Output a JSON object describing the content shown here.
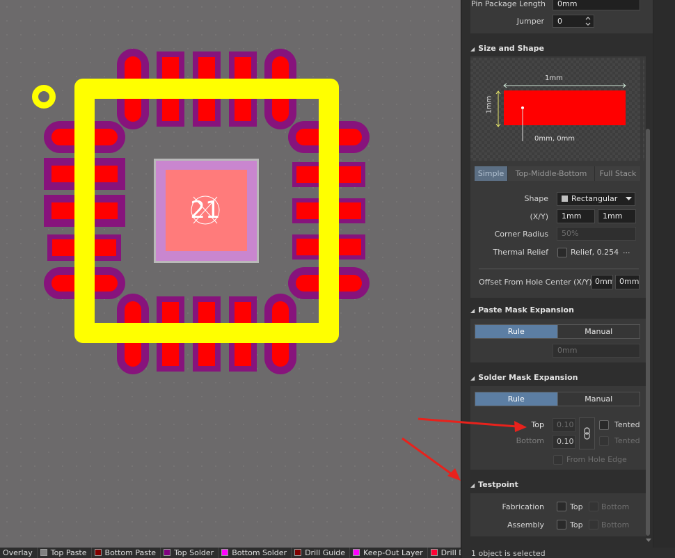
{
  "canvas": {
    "pad_label": "21",
    "colors": {
      "copper": "#ff0000",
      "solder_mask": "#87137c",
      "overlay": "#ffff00",
      "exposed_pad": "#c986cf",
      "paste": "#ff7b7b"
    }
  },
  "layer_tabs": [
    {
      "label": "Overlay",
      "color": ""
    },
    {
      "label": "Top Paste",
      "color": "#808080"
    },
    {
      "label": "Bottom Paste",
      "color": "#800000"
    },
    {
      "label": "Top Solder",
      "color": "#800080"
    },
    {
      "label": "Bottom Solder",
      "color": "#ff00ff"
    },
    {
      "label": "Drill Guide",
      "color": "#800000"
    },
    {
      "label": "Keep-Out Layer",
      "color": "#ff00ff"
    },
    {
      "label": "Drill Dra",
      "color": "#ff0033"
    }
  ],
  "panel": {
    "pin_package_length": {
      "label": "Pin Package Length",
      "value": "0mm"
    },
    "jumper": {
      "label": "Jumper",
      "value": "0"
    },
    "size_shape": {
      "title": "Size and Shape",
      "preview_width": "1mm",
      "preview_height": "1mm",
      "preview_offset": "0mm, 0mm",
      "tabs": [
        "Simple",
        "Top-Middle-Bottom",
        "Full Stack"
      ],
      "shape_label": "Shape",
      "shape_value": "Rectangular",
      "xy_label": "(X/Y)",
      "x_value": "1mm",
      "y_value": "1mm",
      "corner_radius_label": "Corner Radius",
      "corner_radius_value": "50%",
      "thermal_relief_label": "Thermal Relief",
      "thermal_relief_value": "Relief, 0.254r",
      "thermal_more": "...",
      "offset_label": "Offset From Hole Center (X/Y)",
      "offset_x": "0mm",
      "offset_y": "0mm"
    },
    "paste_mask": {
      "title": "Paste Mask Expansion",
      "rule": "Rule",
      "manual": "Manual",
      "value": "0mm"
    },
    "solder_mask": {
      "title": "Solder Mask Expansion",
      "rule": "Rule",
      "manual": "Manual",
      "top_label": "Top",
      "top_value": "0.10",
      "bottom_label": "Bottom",
      "bottom_value": "0.10",
      "tented": "Tented",
      "from_hole_edge": "From Hole Edge"
    },
    "testpoint": {
      "title": "Testpoint",
      "fabrication": "Fabrication",
      "assembly": "Assembly",
      "top": "Top",
      "bottom": "Bottom"
    },
    "status": "1 object is selected"
  }
}
